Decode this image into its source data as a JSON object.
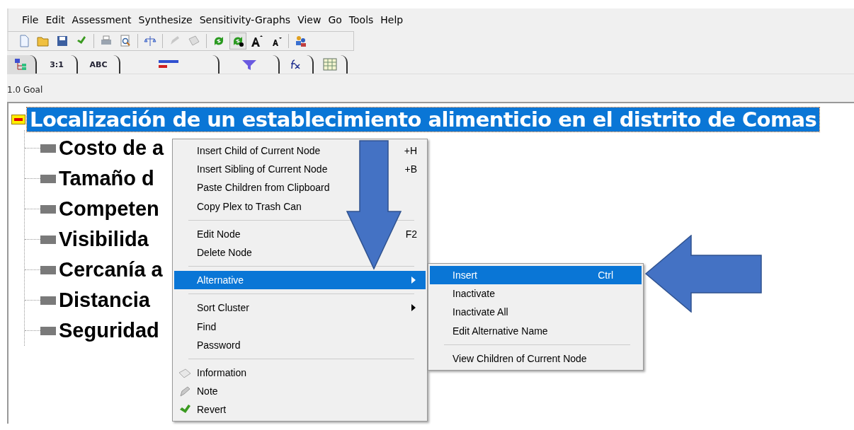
{
  "menu_bar": [
    "File",
    "Edit",
    "Assessment",
    "Synthesize",
    "Sensitivity-Graphs",
    "View",
    "Go",
    "Tools",
    "Help"
  ],
  "toolbar": [
    {
      "kind": "new"
    },
    {
      "kind": "open"
    },
    {
      "kind": "save"
    },
    {
      "kind": "check"
    },
    {
      "kind": "sep"
    },
    {
      "kind": "print"
    },
    {
      "kind": "preview"
    },
    {
      "kind": "sep"
    },
    {
      "kind": "scale"
    },
    {
      "kind": "sep"
    },
    {
      "kind": "gray1"
    },
    {
      "kind": "gray2"
    },
    {
      "kind": "sep"
    },
    {
      "kind": "cycle"
    },
    {
      "kind": "cycle2",
      "selected": true
    },
    {
      "kind": "fontup"
    },
    {
      "kind": "fontdown"
    },
    {
      "kind": "sep"
    },
    {
      "kind": "people"
    }
  ],
  "tabs": [
    {
      "kind": "tree",
      "selected": true
    },
    {
      "kind": "text",
      "label": "3:1",
      "selected": false
    },
    {
      "kind": "text",
      "label": "ABC",
      "selected": false
    },
    {
      "kind": "bars",
      "selected": false
    },
    {
      "kind": "funnel",
      "selected": false
    },
    {
      "kind": "fx",
      "selected": false
    },
    {
      "kind": "grid",
      "selected": false
    }
  ],
  "breadcrumb": "1.0 Goal",
  "tree": {
    "label": "Localización de un establecimiento alimenticio en el distrito de Comas",
    "selected": true,
    "children": [
      {
        "label": "Costo de a"
      },
      {
        "label": "Tamaño d"
      },
      {
        "label": "Competen"
      },
      {
        "label": "Visibilida"
      },
      {
        "label": "Cercanía a"
      },
      {
        "label": "Distancia"
      },
      {
        "label": "Seguridad"
      }
    ]
  },
  "context_menu": [
    {
      "kind": "item",
      "label": "Insert Child of Current Node",
      "shortcut": "+H"
    },
    {
      "kind": "item",
      "label": "Insert Sibling of Current Node",
      "shortcut": "+B"
    },
    {
      "kind": "item",
      "label": "Paste Children from Clipboard"
    },
    {
      "kind": "item",
      "label": "Copy Plex to Trash Can"
    },
    {
      "kind": "separator"
    },
    {
      "kind": "item",
      "label": "Edit Node",
      "shortcut": "F2"
    },
    {
      "kind": "item",
      "label": "Delete Node"
    },
    {
      "kind": "separator"
    },
    {
      "kind": "submenu",
      "label": "Alternative",
      "selected": true
    },
    {
      "kind": "separator"
    },
    {
      "kind": "submenu",
      "label": "Sort Cluster",
      "selected": false
    },
    {
      "kind": "item",
      "label": "Find"
    },
    {
      "kind": "item",
      "label": "Password"
    },
    {
      "kind": "separator"
    },
    {
      "kind": "info",
      "label": "Information"
    },
    {
      "kind": "note",
      "label": "Note"
    },
    {
      "kind": "revert",
      "label": "Revert"
    }
  ],
  "submenu": [
    {
      "kind": "item",
      "label": "Insert",
      "shortcut": "Ctrl",
      "selected": true
    },
    {
      "kind": "item",
      "label": "Inactivate",
      "selected": false
    },
    {
      "kind": "item",
      "label": "Inactivate All",
      "selected": false
    },
    {
      "kind": "item",
      "label": "Edit Alternative Name",
      "selected": false
    },
    {
      "kind": "separator"
    },
    {
      "kind": "item",
      "label": "View Children of Current Node",
      "selected": false
    }
  ]
}
